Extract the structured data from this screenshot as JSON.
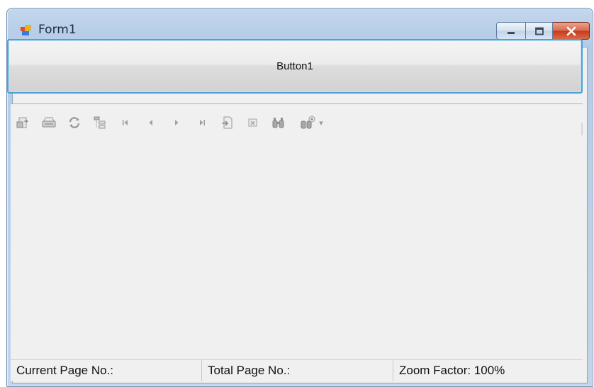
{
  "window": {
    "title": "Form1"
  },
  "main_button": {
    "label": "Button1"
  },
  "toolbar": {
    "icons": [
      "export-icon",
      "print-icon",
      "refresh-icon",
      "group-tree-icon",
      "first-page-icon",
      "previous-page-icon",
      "next-page-icon",
      "last-page-icon",
      "goto-page-icon",
      "close-view-icon",
      "find-icon",
      "zoom-icon"
    ],
    "zoom_dropdown_glyph": "▾"
  },
  "statusbar": {
    "current_page": "Current Page No.:",
    "total_page": "Total Page No.:",
    "zoom_factor": "Zoom Factor: 100%"
  },
  "colors": {
    "title_bar": "#b8cfe8",
    "button_focus_border": "#49a2d9",
    "close_button": "#c8391b",
    "client_bg": "#f0f0f0"
  }
}
